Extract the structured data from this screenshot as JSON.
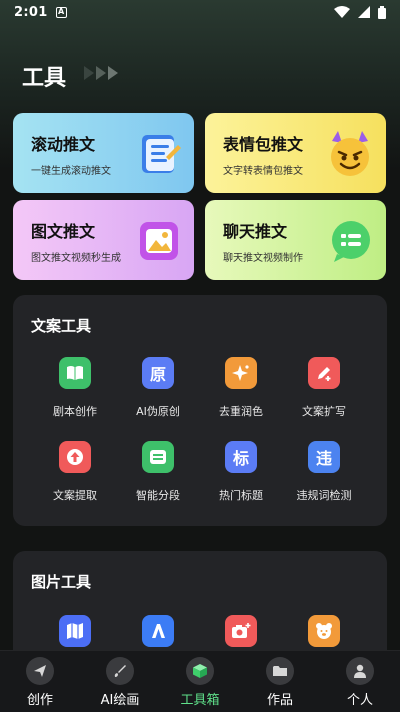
{
  "status_bar": {
    "time": "2:01",
    "badge": "A"
  },
  "header": {
    "title": "工具"
  },
  "feature_cards": [
    {
      "title": "滚动推文",
      "subtitle": "一键生成滚动推文",
      "icon": "notebook-icon"
    },
    {
      "title": "表情包推文",
      "subtitle": "文字转表情包推文",
      "icon": "devil-emoji-icon"
    },
    {
      "title": "图文推文",
      "subtitle": "图文推文视频秒生成",
      "icon": "image-card-icon"
    },
    {
      "title": "聊天推文",
      "subtitle": "聊天推文视频制作",
      "icon": "chat-bubble-icon"
    }
  ],
  "copy_tools": {
    "title": "文案工具",
    "items": [
      {
        "label": "剧本创作",
        "icon": "book-icon",
        "color": "#3ec06a",
        "glyph": ""
      },
      {
        "label": "AI伪原创",
        "icon": "yuan-char-icon",
        "color": "#5b7cf5",
        "glyph": "原"
      },
      {
        "label": "去重润色",
        "icon": "sparkle-icon",
        "color": "#f29a3a",
        "glyph": ""
      },
      {
        "label": "文案扩写",
        "icon": "pen-plus-icon",
        "color": "#f05a5a",
        "glyph": ""
      },
      {
        "label": "文案提取",
        "icon": "upload-arrow-icon",
        "color": "#f05a5a",
        "glyph": ""
      },
      {
        "label": "智能分段",
        "icon": "segment-icon",
        "color": "#3ec06a",
        "glyph": ""
      },
      {
        "label": "热门标题",
        "icon": "biao-char-icon",
        "color": "#5b7cf5",
        "glyph": "标"
      },
      {
        "label": "违规词检测",
        "icon": "wei-char-icon",
        "color": "#4c83f0",
        "glyph": "违"
      }
    ]
  },
  "image_tools": {
    "title": "图片工具",
    "items": [
      {
        "label": "",
        "icon": "map-icon",
        "color": "#4c6ef5"
      },
      {
        "label": "",
        "icon": "letter-a-icon",
        "color": "#3c7cf5"
      },
      {
        "label": "",
        "icon": "camera-plus-icon",
        "color": "#f05a5a"
      },
      {
        "label": "",
        "icon": "bear-icon",
        "color": "#f29a3a"
      }
    ]
  },
  "bottom_nav": {
    "items": [
      {
        "label": "创作",
        "icon": "paper-plane-icon"
      },
      {
        "label": "AI绘画",
        "icon": "brush-icon"
      },
      {
        "label": "工具箱",
        "icon": "cube-icon",
        "active": true
      },
      {
        "label": "作品",
        "icon": "folder-icon"
      },
      {
        "label": "个人",
        "icon": "person-icon"
      }
    ]
  },
  "colors": {
    "accent": "#5fe08a",
    "panel": "#232427",
    "background": "#121413"
  }
}
